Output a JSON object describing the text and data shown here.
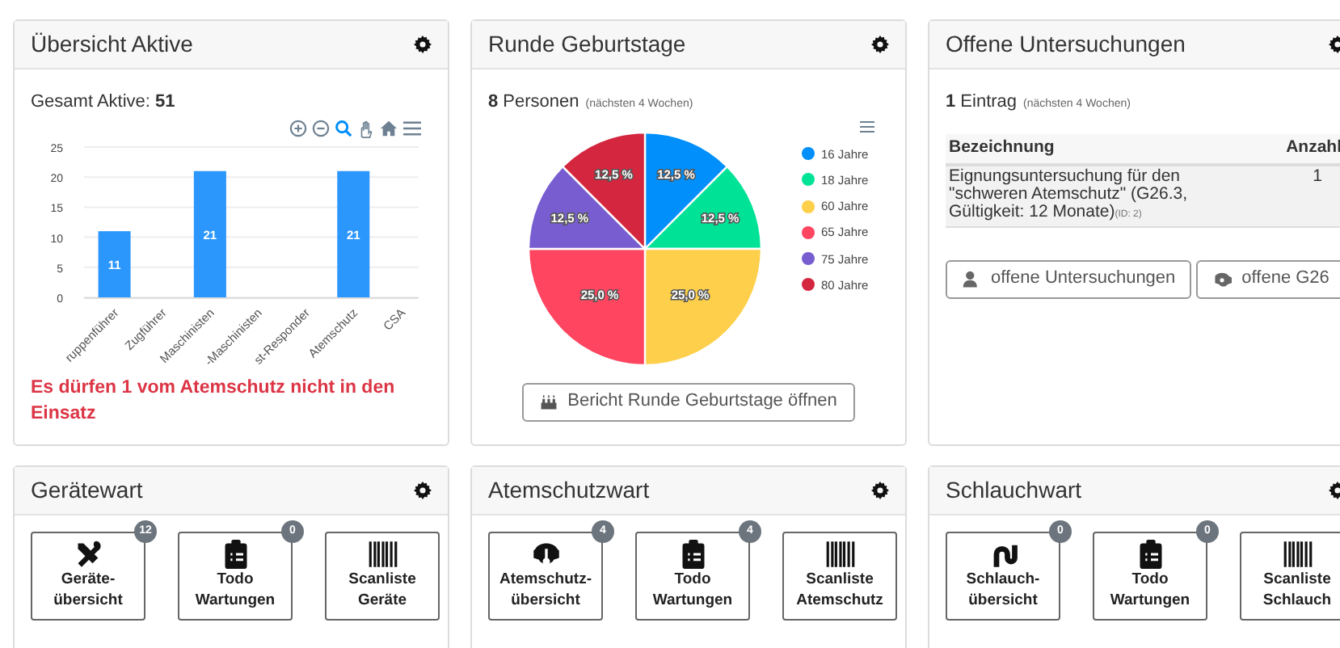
{
  "overview": {
    "title": "Übersicht Aktive",
    "total_label": "Gesamt Aktive:",
    "total": "51",
    "chart_data": {
      "type": "bar",
      "categories": [
        "ruppenführer",
        "Zugführer",
        "Maschinisten",
        "-Maschinisten",
        "st-Responder",
        "Atemschutz",
        "CSA"
      ],
      "values": [
        11,
        0,
        21,
        0,
        0,
        21,
        0
      ],
      "ylim": [
        0,
        25
      ],
      "yticks": [
        0,
        5,
        10,
        15,
        20,
        25
      ],
      "grid": true,
      "value_labels": [
        "11",
        null,
        "21",
        null,
        null,
        "21",
        null
      ]
    },
    "warning": "Es dürfen 1 vom Atemschutz nicht in den Einsatz"
  },
  "birthdays": {
    "title": "Runde Geburtstage",
    "count": "8",
    "count_label": "Personen",
    "range": "(nächsten 4 Wochen)",
    "chart_data": {
      "type": "pie",
      "categories": [
        "16 Jahre",
        "18 Jahre",
        "60 Jahre",
        "65 Jahre",
        "75 Jahre",
        "80 Jahre"
      ],
      "values": [
        12.5,
        12.5,
        25,
        25,
        12.5,
        12.5
      ],
      "colors": [
        "#008ffb",
        "#00e396",
        "#fdcf4a",
        "#ff4560",
        "#775dd0",
        "#d4263e"
      ],
      "legend": "right",
      "value_labels": [
        "12,5 %",
        "12,5 %",
        "25,0 %",
        "25,0 %",
        "12,5 %",
        "12,5 %"
      ]
    },
    "button": "Bericht Runde Geburtstage öffnen"
  },
  "exams": {
    "title": "Offene Untersuchungen",
    "count": "1",
    "count_label": "Eintrag",
    "range": "(nächsten 4 Wochen)",
    "columns": [
      "Bezeichnung",
      "Anzahl"
    ],
    "rows": [
      {
        "name": "Eignungsuntersuchung für den \"schweren Atemschutz\" (G26.3, Gültigkeit: 12 Monate)",
        "id": "(ID: 2)",
        "count": "1"
      }
    ],
    "buttons": [
      "offene Untersuchungen",
      "offene G26"
    ]
  },
  "wardens": [
    {
      "title": "Gerätewart",
      "tiles": [
        {
          "label": "Geräte-übersicht",
          "badge": "12"
        },
        {
          "label": "Todo Wartungen",
          "badge": "0"
        },
        {
          "label": "Scanliste Geräte"
        }
      ]
    },
    {
      "title": "Atemschutzwart",
      "tiles": [
        {
          "label": "Atemschutz-übersicht",
          "badge": "4"
        },
        {
          "label": "Todo Wartungen",
          "badge": "4"
        },
        {
          "label": "Scanliste Atemschutz"
        }
      ]
    },
    {
      "title": "Schlauchwart",
      "tiles": [
        {
          "label": "Schlauch-übersicht",
          "badge": "0"
        },
        {
          "label": "Todo Wartungen",
          "badge": "0"
        },
        {
          "label": "Scanliste Schlauch"
        }
      ]
    }
  ]
}
